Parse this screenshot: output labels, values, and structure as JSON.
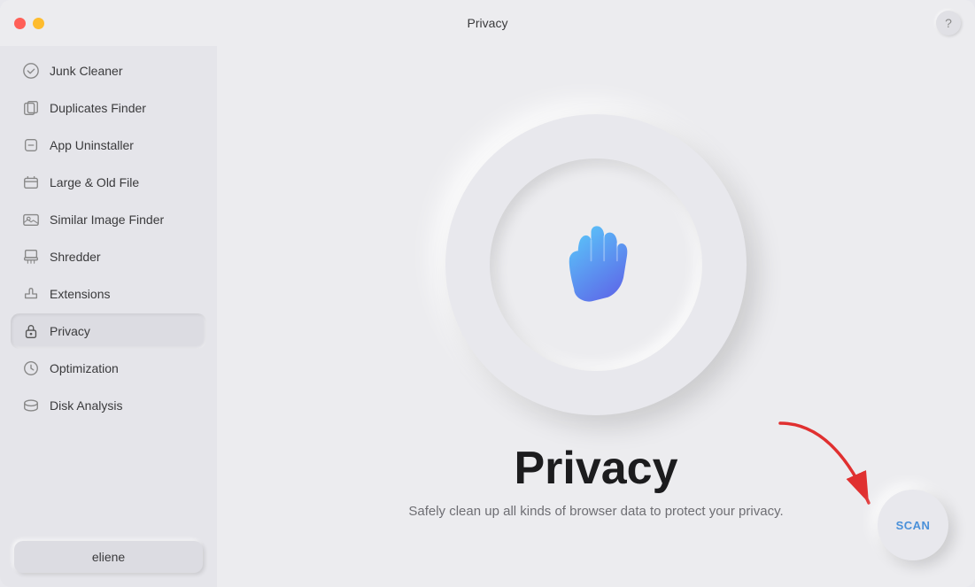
{
  "titlebar": {
    "title": "Privacy",
    "help_label": "?"
  },
  "sidebar": {
    "items": [
      {
        "id": "junk-cleaner",
        "label": "Junk Cleaner",
        "icon": "junk"
      },
      {
        "id": "duplicates-finder",
        "label": "Duplicates Finder",
        "icon": "duplicates"
      },
      {
        "id": "app-uninstaller",
        "label": "App Uninstaller",
        "icon": "uninstaller"
      },
      {
        "id": "large-old-file",
        "label": "Large & Old File",
        "icon": "large"
      },
      {
        "id": "similar-image-finder",
        "label": "Similar Image Finder",
        "icon": "image"
      },
      {
        "id": "shredder",
        "label": "Shredder",
        "icon": "shredder"
      },
      {
        "id": "extensions",
        "label": "Extensions",
        "icon": "extensions"
      },
      {
        "id": "privacy",
        "label": "Privacy",
        "icon": "privacy",
        "active": true
      },
      {
        "id": "optimization",
        "label": "Optimization",
        "icon": "optimization"
      },
      {
        "id": "disk-analysis",
        "label": "Disk Analysis",
        "icon": "disk"
      }
    ],
    "user": {
      "label": "eliene"
    }
  },
  "main": {
    "title": "Privacy",
    "subtitle": "Safely clean up all kinds of browser data to protect your privacy.",
    "scan_label": "SCAN"
  },
  "colors": {
    "accent_blue": "#4a90d9",
    "active_bg": "#dcdce2",
    "arrow_red": "#e03030"
  }
}
